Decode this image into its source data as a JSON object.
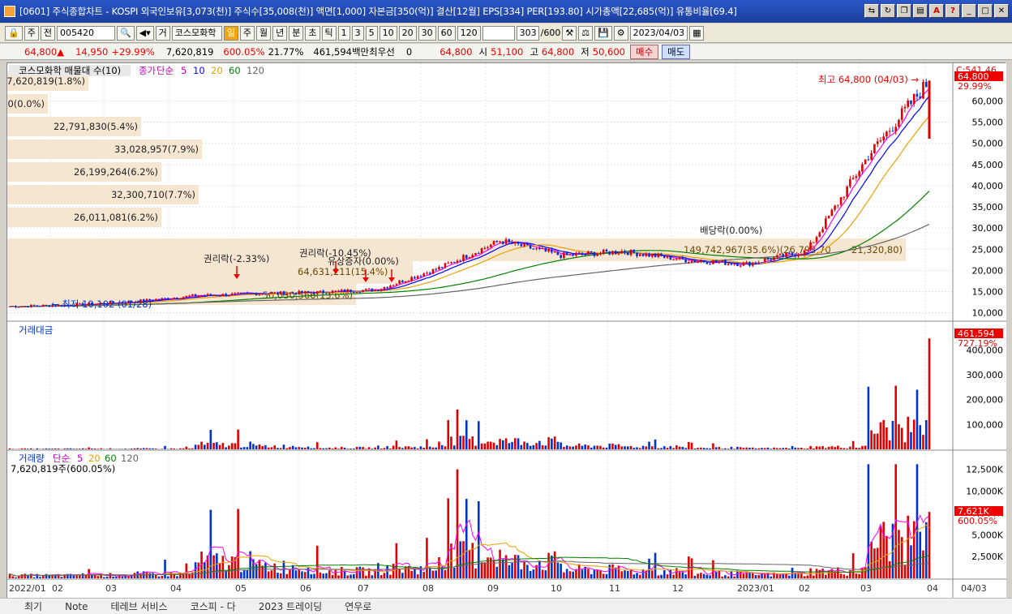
{
  "title": "[0601] 주식종합차트 - KOSPI 외국인보유[3,073(천)] 주식수[35,008(천)] 액면[1,000] 자본금[350(억)] 결산[12월] EPS[334] PER[193.80] 시가총액[22,685(억)] 유통비율[69.4]",
  "toolbar": {
    "period": "주",
    "code_prefix": "전",
    "code": "005420",
    "name_prefix": "거",
    "stock_name": "코스모화학",
    "tabs": [
      "일",
      "주",
      "월",
      "년",
      "분",
      "초",
      "틱"
    ],
    "active_tab": "일",
    "intervals": [
      "1",
      "3",
      "5",
      "10",
      "20",
      "30",
      "60",
      "120"
    ],
    "count": "303",
    "max_count": "/600",
    "date": "2023/04/03"
  },
  "info": {
    "price": "64,800",
    "arrow": "▲",
    "change": "14,950",
    "change_pct": "+29.99%",
    "volume": "7,620,819",
    "volume_pct": "600.05%",
    "turnover": "21.77%",
    "amount": "461,594백만",
    "priority_label": "최우선",
    "priority_val": "0",
    "ask": "64,800",
    "open_label": "시",
    "open": "51,100",
    "high_label": "고",
    "high": "64,800",
    "low_label": "저",
    "low": "50,600",
    "buy": "매수",
    "sell": "매도"
  },
  "panel1": {
    "title": "코스모화학 매물대 수(10)",
    "legend": [
      "종가",
      "단순",
      "5",
      "10",
      "20",
      "60",
      "120"
    ],
    "top_label": "C:541.46",
    "price_tag": "64,800",
    "pct_tag": "29.99%",
    "high_note": "최고 64,800 (04/03) →",
    "low_note": "← 최저 10,102 (01/28)",
    "volume_profile": [
      "7,620,819(1.8%)",
      "0(0.0%)",
      "22,791,830(5.4%)",
      "33,028,957(7.9%)",
      "26,199,264(6.2%)",
      "32,300,710(7.7%)",
      "26,011,081(6.2%)",
      "149,742,967(35.6%)(26,793,70",
      "21,320,80)",
      "64,631,211(15.4%)",
      "50,030,566(13.6%)"
    ],
    "events": [
      "권리락(-2.33%)",
      "권리락(-10.45%)",
      "유상증자(0.00%)",
      "배당락(0.00%)"
    ],
    "axis": [
      "60,000",
      "55,000",
      "50,000",
      "45,000",
      "40,000",
      "35,000",
      "30,000",
      "25,000",
      "20,000",
      "15,000",
      "10,000"
    ]
  },
  "panel2": {
    "title": "거래대금",
    "value_tag": "461,594",
    "pct_tag": "727.19%",
    "axis": [
      "400,000",
      "300,000",
      "200,000",
      "100,000"
    ]
  },
  "panel3": {
    "title": "거래량",
    "legend": [
      "단순",
      "5",
      "20",
      "60",
      "120"
    ],
    "sub": "7,620,819주(600.05%)",
    "value_tag": "7,621K",
    "pct_tag": "600.05%",
    "axis": [
      "12,500K",
      "10,000K",
      "7,500K",
      "5,000K",
      "2,500K"
    ]
  },
  "xaxis": [
    "2022/01",
    "02",
    "03",
    "04",
    "05",
    "06",
    "07",
    "08",
    "09",
    "10",
    "11",
    "12",
    "2023/01",
    "02",
    "03",
    "04",
    "04/03"
  ],
  "bottom": [
    "최기",
    "Note",
    "테레브 서비스",
    "코스피 - 다",
    "2023 트레이딩",
    "연우로"
  ],
  "colors": {
    "up": "#e00000",
    "down": "#0033cc",
    "ma5": "#ff00ff",
    "ma10": "#0000ff",
    "ma20": "#e8a000",
    "ma60": "#008000",
    "ma120": "#666666",
    "profile": "#f5e6d2"
  },
  "chart_data": [
    {
      "type": "candlestick",
      "title": "코스모화학 매물대 수(10)",
      "x": [
        "2022/01",
        "02",
        "03",
        "04",
        "05",
        "06",
        "07",
        "08",
        "09",
        "10",
        "11",
        "12",
        "2023/01",
        "02",
        "03",
        "04"
      ],
      "close": [
        11500,
        11800,
        12600,
        14000,
        14500,
        14800,
        15500,
        20500,
        27000,
        23500,
        24500,
        22500,
        21500,
        24500,
        47000,
        64800
      ],
      "ylim": [
        10000,
        65000
      ]
    },
    {
      "type": "bar",
      "title": "거래대금",
      "x": [
        "2022/01",
        "02",
        "03",
        "04",
        "05",
        "06",
        "07",
        "08",
        "09",
        "10",
        "11",
        "12",
        "2023/01",
        "02",
        "03",
        "04"
      ],
      "values": [
        8000,
        9000,
        10000,
        60000,
        40000,
        20000,
        30000,
        110000,
        100000,
        45000,
        35000,
        20000,
        15000,
        30000,
        250000,
        461594
      ],
      "ylim": [
        0,
        461594
      ]
    },
    {
      "type": "bar",
      "title": "거래량",
      "x": [
        "2022/01",
        "02",
        "03",
        "04",
        "05",
        "06",
        "07",
        "08",
        "09",
        "10",
        "11",
        "12",
        "2023/01",
        "02",
        "03",
        "04"
      ],
      "values": [
        600,
        700,
        900,
        3500,
        2500,
        1500,
        2000,
        5000,
        3500,
        1800,
        1500,
        1000,
        800,
        1500,
        8000,
        7621
      ],
      "ylim": [
        0,
        13000
      ]
    }
  ]
}
